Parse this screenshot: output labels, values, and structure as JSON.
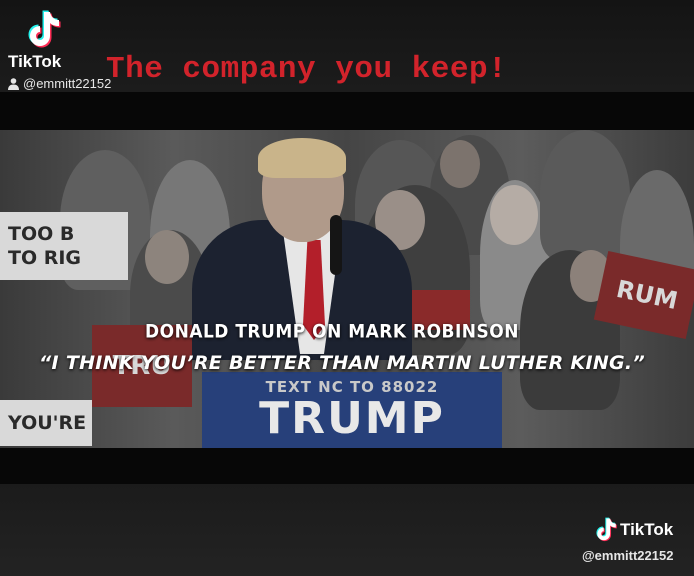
{
  "watermark_top": {
    "brand": "TikTok",
    "username": "@emmitt22152",
    "logo_icon": "tiktok-logo-icon",
    "user_icon": "person-icon"
  },
  "headline": {
    "text": "The company you keep!",
    "color": "#d2232b"
  },
  "video": {
    "caption_title": "DONALD TRUMP ON MARK ROBINSON",
    "caption_quote": "“I THINK YOU’RE BETTER THAN MARTIN LUTHER KING.”",
    "signs": {
      "left_top_line1": "TOO B",
      "left_top_line2": "TO RIG",
      "left_bottom": "YOU'RE",
      "left_red": "TRU",
      "right_red": "RUM",
      "podium_small": "TEXT NC TO 88022",
      "podium_big": "TRUMP"
    }
  },
  "watermark_bottom": {
    "brand": "TikTok",
    "username": "@emmitt22152",
    "logo_icon": "tiktok-logo-icon"
  }
}
